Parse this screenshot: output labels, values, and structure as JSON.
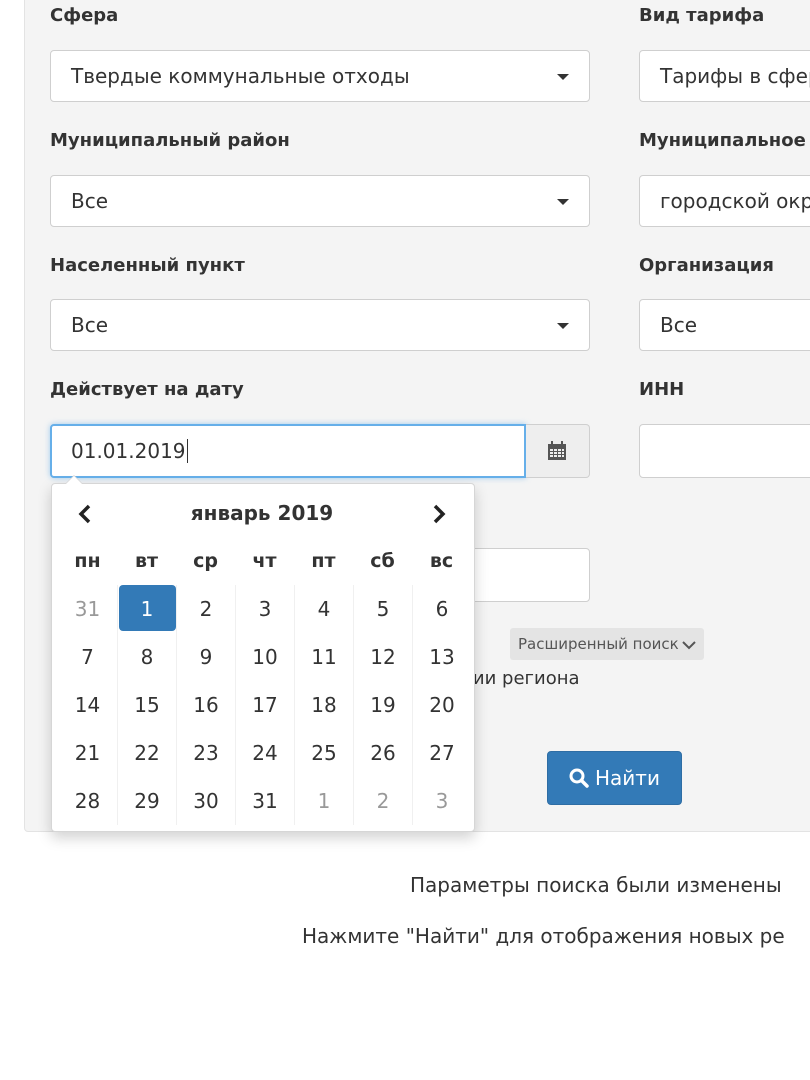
{
  "labels": {
    "sphere": "Сфера",
    "tariff_type": "Вид тарифа",
    "municipal_district": "Муниципальный район",
    "municipal_entity": "Муниципальное о",
    "settlement": "Населенный пункт",
    "organization": "Организация",
    "valid_on_date": "Действует на дату",
    "inn": "ИНН"
  },
  "fields": {
    "sphere": "Твердые коммунальные отходы",
    "tariff_type": "Тарифы в сфер",
    "municipal_district": "Все",
    "municipal_entity": "городской окр",
    "settlement": "Все",
    "organization": "Все",
    "date": "01.01.2019"
  },
  "datepicker": {
    "title": "январь 2019",
    "weekdays": [
      "пн",
      "вт",
      "ср",
      "чт",
      "пт",
      "сб",
      "вс"
    ],
    "weeks": [
      [
        "31",
        "1",
        "2",
        "3",
        "4",
        "5",
        "6"
      ],
      [
        "7",
        "8",
        "9",
        "10",
        "11",
        "12",
        "13"
      ],
      [
        "14",
        "15",
        "16",
        "17",
        "18",
        "19",
        "20"
      ],
      [
        "21",
        "22",
        "23",
        "24",
        "25",
        "26",
        "27"
      ],
      [
        "28",
        "29",
        "30",
        "31",
        "1",
        "2",
        "3"
      ]
    ],
    "selected": "1"
  },
  "advanced_search": "Расширенный поиск",
  "region_text": "тории региона",
  "find_button": "Найти",
  "messages": {
    "line1": "Параметры поиска были изменены",
    "line2": "Нажмите \"Найти\" для отображения новых ре"
  },
  "colors": {
    "primary": "#337ab7",
    "focus_border": "#66afe9"
  }
}
